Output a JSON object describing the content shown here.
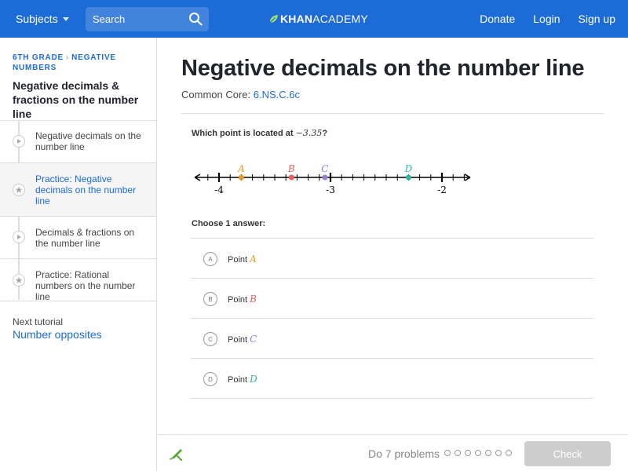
{
  "nav": {
    "subjects_label": "Subjects",
    "search_placeholder": "Search",
    "logo_khan": "KHAN",
    "logo_academy": "ACADEMY",
    "links": [
      "Donate",
      "Login",
      "Sign up"
    ]
  },
  "sidebar": {
    "breadcrumb": [
      "6TH GRADE",
      "NEGATIVE NUMBERS"
    ],
    "title": "Negative decimals & fractions on the number line",
    "items": [
      {
        "label": "Negative decimals on the number line",
        "icon": "play-icon",
        "active": false
      },
      {
        "label": "Practice: Negative decimals on the number line",
        "icon": "star-icon",
        "active": true
      },
      {
        "label": "Decimals & fractions on the number line",
        "icon": "play-icon",
        "active": false
      },
      {
        "label": "Practice: Rational numbers on the number line",
        "icon": "star-icon",
        "active": false
      }
    ],
    "next_label": "Next tutorial",
    "next_link": "Number opposites"
  },
  "main": {
    "title": "Negative decimals on the number line",
    "common_core_label": "Common Core:",
    "common_core_code": "6.NS.C.6c",
    "question_prefix": "Which point is located at ",
    "question_value": "−3.35",
    "question_suffix": "?",
    "choose_label": "Choose 1 answer:",
    "choices": [
      {
        "letter": "A",
        "text": "Point",
        "var": "A",
        "color": "#e89a2c"
      },
      {
        "letter": "B",
        "text": "Point",
        "var": "B",
        "color": "#e8605a"
      },
      {
        "letter": "C",
        "text": "Point",
        "var": "C",
        "color": "#9a7cd4"
      },
      {
        "letter": "D",
        "text": "Point",
        "var": "D",
        "color": "#2fb5a0"
      }
    ]
  },
  "numberline": {
    "min": -4.2,
    "max": -1.75,
    "labels": [
      "-4",
      "-3",
      "-2"
    ],
    "points": [
      {
        "name": "A",
        "value": -3.8,
        "color": "#e89a2c"
      },
      {
        "name": "B",
        "value": -3.35,
        "color": "#e8605a"
      },
      {
        "name": "C",
        "value": -3.05,
        "color": "#9a7cd4"
      },
      {
        "name": "D",
        "value": -2.3,
        "color": "#2fb5a0"
      }
    ]
  },
  "footer": {
    "do_problems": "Do 7 problems",
    "progress_total": 7,
    "check_label": "Check"
  },
  "colors": {
    "brand": "#1c6bd6",
    "check_disabled": "#cdcdcd",
    "pencil": "#5aa83a"
  }
}
